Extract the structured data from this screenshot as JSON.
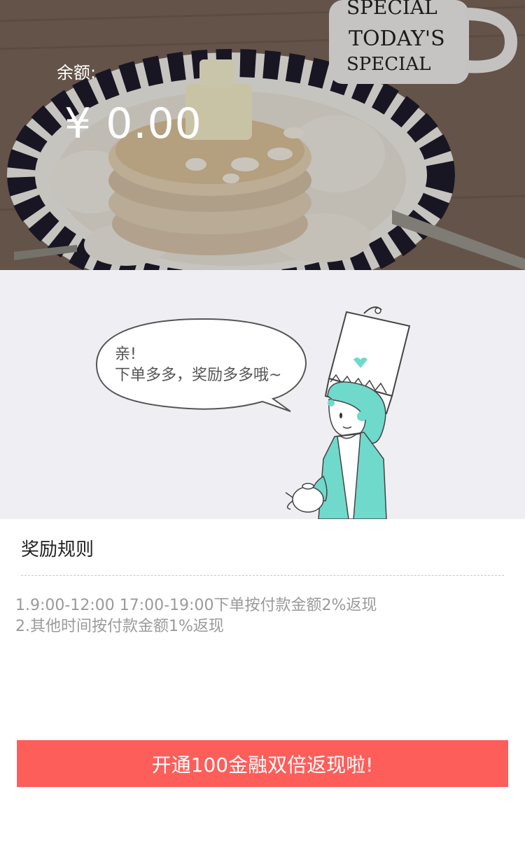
{
  "balance": {
    "label": "余额:",
    "amount": "¥ 0.00"
  },
  "hero_image": {
    "mug_text_1": "SPECIAL",
    "mug_text_2": "TODAY'S",
    "mug_text_3": "SPECIAL"
  },
  "banner": {
    "bubble_line1": "亲!",
    "bubble_line2": "下单多多，奖励多多哦~",
    "accent_color": "#6fd9cc"
  },
  "rules": {
    "title": "奖励规则",
    "items": [
      "1.9:00-12:00 17:00-19:00下单按付款金额2%返现",
      " 2.其他时间按付款金额1%返现"
    ]
  },
  "cta": {
    "label": "开通100金融双倍返现啦!",
    "color": "#fd5e5a"
  }
}
